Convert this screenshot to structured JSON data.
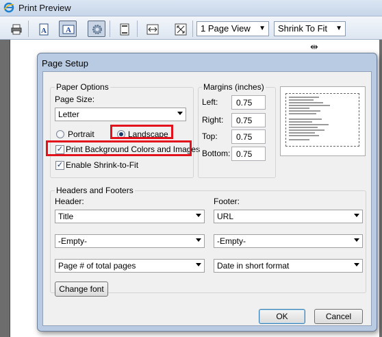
{
  "window": {
    "title": "Print Preview",
    "logo_icon": "ie-logo-icon"
  },
  "toolbar": {
    "buttons": [
      {
        "name": "print-icon"
      },
      {
        "name": "portrait-icon"
      },
      {
        "name": "landscape-icon",
        "pressed": true
      },
      {
        "name": "page-setup-gear-icon"
      },
      {
        "name": "header-footer-icon"
      },
      {
        "name": "full-width-icon"
      },
      {
        "name": "full-page-icon"
      }
    ],
    "view_select": "1 Page View",
    "shrink_select": "Shrink To Fit"
  },
  "dialog": {
    "title": "Page Setup",
    "paper_options": {
      "label": "Paper Options",
      "page_size_label": "Page Size:",
      "page_size_value": "Letter",
      "portrait_label": "Portrait",
      "landscape_label": "Landscape",
      "orientation": "Landscape",
      "print_bg_label": "Print Background Colors and Images",
      "print_bg_checked": true,
      "shrink_label": "Enable Shrink-to-Fit",
      "shrink_checked": true
    },
    "margins": {
      "label": "Margins (inches)",
      "left_label": "Left:",
      "left_value": "0.75",
      "right_label": "Right:",
      "right_value": "0.75",
      "top_label": "Top:",
      "top_value": "0.75",
      "bottom_label": "Bottom:",
      "bottom_value": "0.75"
    },
    "headers_footers": {
      "label": "Headers and Footers",
      "header_label": "Header:",
      "footer_label": "Footer:",
      "header_1": "Title",
      "header_2": "-Empty-",
      "header_3": "Page # of total pages",
      "footer_1": "URL",
      "footer_2": "-Empty-",
      "footer_3": "Date in short format",
      "change_font": "Change font"
    },
    "ok": "OK",
    "cancel": "Cancel"
  },
  "colors": {
    "highlight": "#e3111b",
    "dialog_frame": "#b9cbe2"
  }
}
